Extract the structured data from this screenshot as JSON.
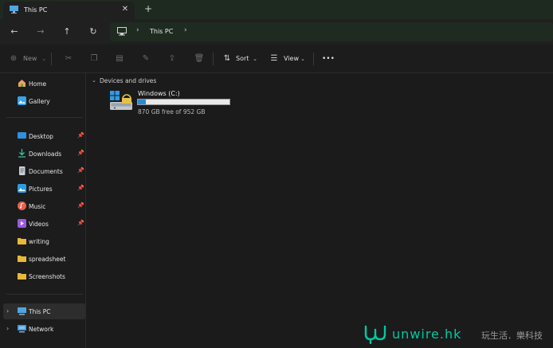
{
  "window": {
    "tab_title": "This PC",
    "close_glyph": "✕",
    "add_glyph": "+"
  },
  "nav": {
    "back_glyph": "←",
    "forward_glyph": "→",
    "up_glyph": "↑",
    "refresh_glyph": "↻",
    "breadcrumb": [
      "This PC"
    ],
    "chevron_glyph": "›"
  },
  "commands": {
    "new_label": "New",
    "sort_label": "Sort",
    "view_label": "View",
    "more_glyph": "•••",
    "icons": [
      "cut-icon",
      "copy-icon",
      "paste-icon",
      "rename-icon",
      "share-icon",
      "delete-icon"
    ]
  },
  "sidebar": {
    "top": [
      {
        "label": "Home",
        "icon": "home-icon"
      },
      {
        "label": "Gallery",
        "icon": "gallery-icon"
      }
    ],
    "pinned": [
      {
        "label": "Desktop",
        "icon": "desktop-icon",
        "pinned": true
      },
      {
        "label": "Downloads",
        "icon": "download-icon",
        "pinned": true
      },
      {
        "label": "Documents",
        "icon": "documents-icon",
        "pinned": true
      },
      {
        "label": "Pictures",
        "icon": "pictures-icon",
        "pinned": true
      },
      {
        "label": "Music",
        "icon": "music-icon",
        "pinned": true
      },
      {
        "label": "Videos",
        "icon": "videos-icon",
        "pinned": true
      },
      {
        "label": "writing",
        "icon": "folder-icon",
        "pinned": false
      },
      {
        "label": "spreadsheet",
        "icon": "folder-icon",
        "pinned": false
      },
      {
        "label": "Screenshots",
        "icon": "folder-icon",
        "pinned": false
      }
    ],
    "bottom": [
      {
        "label": "This PC",
        "icon": "this-pc-icon",
        "selected": true
      },
      {
        "label": "Network",
        "icon": "network-icon",
        "selected": false
      }
    ]
  },
  "main": {
    "group_header": "Devices and drives",
    "drives": [
      {
        "name": "Windows (C:)",
        "free_text": "870 GB free of 952 GB",
        "used_fraction": 0.086
      }
    ]
  },
  "watermark": {
    "brand": "unwire.hk",
    "tagline": "玩生活．樂科技"
  },
  "colors": {
    "accent": "#2a8ad4",
    "brand": "#00c9a0",
    "folder": "#e8b83a"
  }
}
